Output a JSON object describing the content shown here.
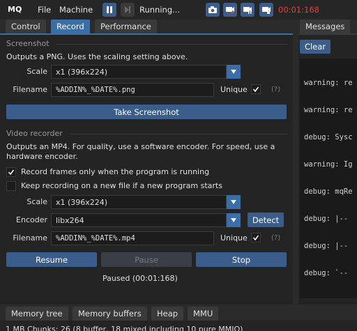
{
  "app": {
    "name": "MQ"
  },
  "menu": {
    "file": "File",
    "machine": "Machine"
  },
  "toolbar": {
    "status": "Running...",
    "timer": "00:01:168"
  },
  "tabs": {
    "control": "Control",
    "record": "Record",
    "performance": "Performance",
    "messages": "Messages"
  },
  "screenshot": {
    "heading": "Screenshot",
    "description": "Outputs a PNG. Uses the scaling setting above.",
    "scale_label": "Scale",
    "scale_value": "x1 (396x224)",
    "filename_label": "Filename",
    "filename_value": "%ADDIN%_%DATE%.png",
    "unique_label": "Unique",
    "help": "(?)",
    "button": "Take Screenshot"
  },
  "video": {
    "heading": "Video recorder",
    "description": "Outputs an MP4. For quality, use a software encoder. For speed, use a hardware encoder.",
    "check_running": "Record frames only when the program is running",
    "check_new_file": "Keep recording on a new file if a new program starts",
    "scale_label": "Scale",
    "scale_value": "x1 (396x224)",
    "encoder_label": "Encoder",
    "encoder_value": "libx264",
    "detect": "Detect",
    "filename_label": "Filename",
    "filename_value": "%ADDIN%_%DATE%.mp4",
    "unique_label": "Unique",
    "help": "(?)",
    "resume": "Resume",
    "pause": "Pause",
    "stop": "Stop",
    "status": "Paused (00:01:168)"
  },
  "messages": {
    "clear": "Clear",
    "lines": [
      "warning: re",
      "warning: re",
      "debug: Sysc",
      "warning: Ig",
      "debug: mqRe",
      "debug: |--",
      "debug: |--",
      "debug: `--"
    ]
  },
  "bottom_tabs": {
    "memory_tree": "Memory tree",
    "memory_buffers": "Memory buffers",
    "heap": "Heap",
    "mmu": "MMU"
  },
  "bottom_status": "1 MB Chunks: 26 (8 buffer, 18 mixed including 10 pure MMIO)",
  "colors": {
    "accent": "#3a6ea8",
    "timer": "#e04040",
    "background": "#2b2b2b"
  }
}
